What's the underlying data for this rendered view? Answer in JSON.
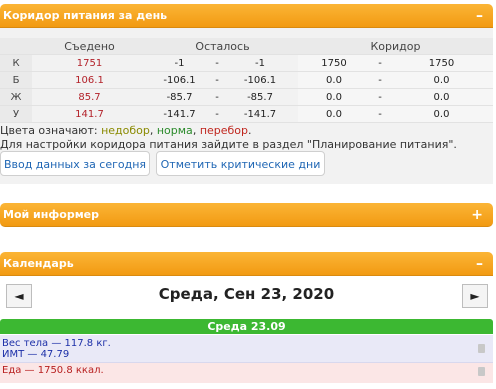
{
  "nutrition": {
    "title": "Коридор питания за день",
    "collapse_icon": "–",
    "headers": {
      "eaten": "Съедено",
      "remaining": "Осталось",
      "corridor": "Коридор"
    },
    "rows": [
      {
        "label": "К",
        "eaten": "1751",
        "rem_a": "-1",
        "dash1": "-",
        "rem_b": "-1",
        "cor_a": "1750",
        "dash2": "-",
        "cor_b": "1750"
      },
      {
        "label": "Б",
        "eaten": "106.1",
        "rem_a": "-106.1",
        "dash1": "-",
        "rem_b": "-106.1",
        "cor_a": "0.0",
        "dash2": "-",
        "cor_b": "0.0"
      },
      {
        "label": "Ж",
        "eaten": "85.7",
        "rem_a": "-85.7",
        "dash1": "-",
        "rem_b": "-85.7",
        "cor_a": "0.0",
        "dash2": "-",
        "cor_b": "0.0"
      },
      {
        "label": "У",
        "eaten": "141.7",
        "rem_a": "-141.7",
        "dash1": "-",
        "rem_b": "-141.7",
        "cor_a": "0.0",
        "dash2": "-",
        "cor_b": "0.0"
      }
    ],
    "legend_prefix": "Цвета означают: ",
    "legend_low": "недобор",
    "legend_sep1": ", ",
    "legend_norm": "норма",
    "legend_sep2": ", ",
    "legend_over": "перебор",
    "legend_end": ".",
    "hint": "Для настройки коридора питания зайдите в раздел \"Планирование питания\".",
    "btn_enter": "Ввод данных за сегодня",
    "btn_critical": "Отметить критические дни"
  },
  "informer": {
    "title": "Мой информер",
    "expand_icon": "+"
  },
  "calendar": {
    "title": "Календарь",
    "collapse_icon": "–",
    "prev_icon": "◄",
    "next_icon": "►",
    "date_title": "Среда, Сен 23, 2020",
    "day_label": "Среда 23.09",
    "weight_line": "Вес тела — 117.8 кг.",
    "bmi_line": "ИМТ — 47.79",
    "food_line": "Еда — 1750.8 ккал."
  },
  "colors": {
    "header": "#f29a12",
    "day_bar": "#3cb832",
    "over": "#c0261e",
    "norm": "#2a8a2a",
    "low": "#8a8a00"
  }
}
